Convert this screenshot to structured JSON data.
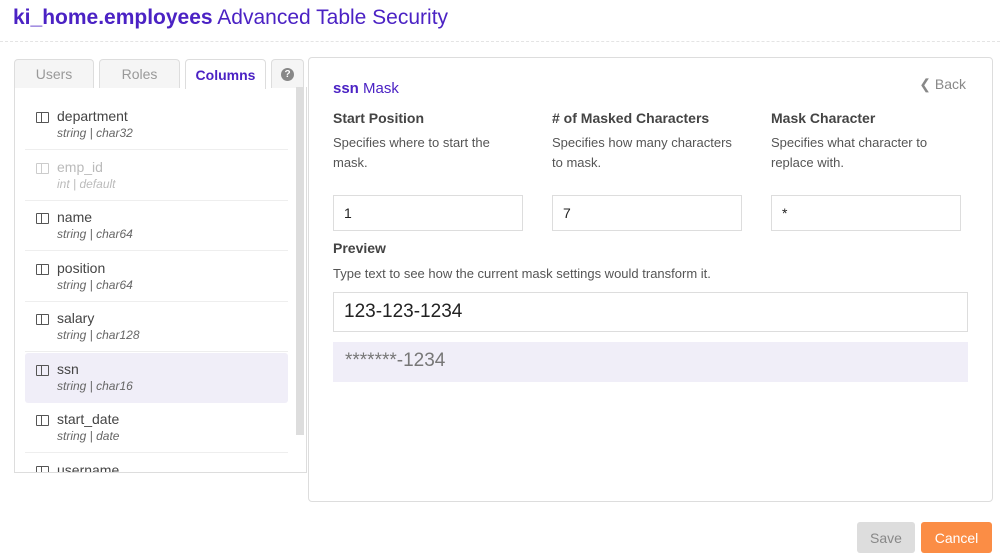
{
  "header": {
    "table": "ki_home.employees",
    "subtitle": "Advanced Table Security"
  },
  "tabs": [
    {
      "label": "Users"
    },
    {
      "label": "Roles"
    },
    {
      "label": "Columns"
    }
  ],
  "columns": [
    {
      "name": "department",
      "type": "string | char32"
    },
    {
      "name": "emp_id",
      "type": "int | default"
    },
    {
      "name": "name",
      "type": "string | char64"
    },
    {
      "name": "position",
      "type": "string | char64"
    },
    {
      "name": "salary",
      "type": "string | char128"
    },
    {
      "name": "ssn",
      "type": "string | char16"
    },
    {
      "name": "start_date",
      "type": "string | date"
    },
    {
      "name": "username",
      "type": ""
    }
  ],
  "mask": {
    "column": "ssn",
    "title": "Mask",
    "back": "Back",
    "start": {
      "label": "Start Position",
      "desc": "Specifies where to start the mask.",
      "value": "1"
    },
    "count": {
      "label": "# of Masked Characters",
      "desc": "Specifies how many characters to mask.",
      "value": "7"
    },
    "char": {
      "label": "Mask Character",
      "desc": "Specifies what character to replace with.",
      "value": "*"
    },
    "preview": {
      "label": "Preview",
      "desc": "Type text to see how the current mask settings would transform it.",
      "input": "123-123-1234",
      "output": "*******-1234"
    }
  },
  "buttons": {
    "save": "Save",
    "cancel": "Cancel"
  }
}
